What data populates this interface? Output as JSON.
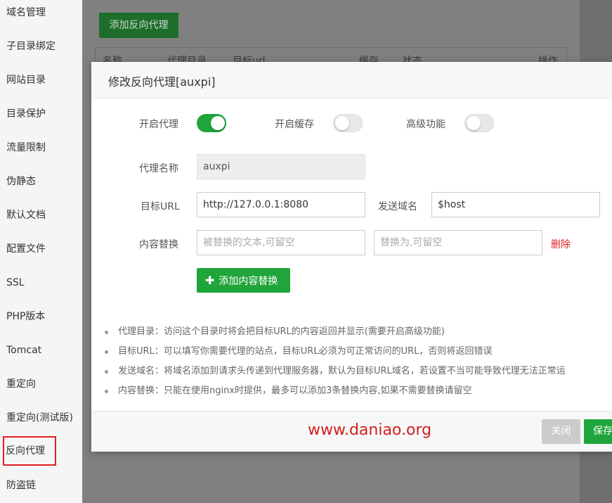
{
  "sidebar": {
    "items": [
      {
        "label": "域名管理"
      },
      {
        "label": "子目录绑定"
      },
      {
        "label": "网站目录"
      },
      {
        "label": "目录保护"
      },
      {
        "label": "流量限制"
      },
      {
        "label": "伪静态"
      },
      {
        "label": "默认文档"
      },
      {
        "label": "配置文件"
      },
      {
        "label": "SSL"
      },
      {
        "label": "PHP版本"
      },
      {
        "label": "Tomcat"
      },
      {
        "label": "重定向"
      },
      {
        "label": "重定向(测试版)"
      },
      {
        "label": "反向代理"
      },
      {
        "label": "防盗链"
      }
    ],
    "active": "反向代理"
  },
  "background": {
    "add_button": "添加反向代理",
    "table_headers": [
      "名称",
      "代理目录",
      "目标url",
      "缓存",
      "状态",
      "操作"
    ]
  },
  "modal": {
    "title": "修改反向代理[auxpi]",
    "toggles": {
      "proxy_label": "开启代理",
      "proxy_on": true,
      "cache_label": "开启缓存",
      "cache_on": false,
      "advanced_label": "高级功能",
      "advanced_on": false
    },
    "form": {
      "name_label": "代理名称",
      "name_value": "auxpi",
      "target_label": "目标URL",
      "target_value": "http://127.0.0.1:8080",
      "host_label": "发送域名",
      "host_value": "$host",
      "replace_label": "内容替换",
      "replace_from_placeholder": "被替换的文本,可留空",
      "replace_to_placeholder": "替换为,可留空",
      "delete_label": "删除",
      "add_replace_label": "添加内容替换"
    },
    "tips": [
      "代理目录：访问这个目录时将会把目标URL的内容返回并显示(需要开启高级功能)",
      "目标URL：可以填写你需要代理的站点，目标URL必须为可正常访问的URL，否则将返回错误",
      "发送域名：将域名添加到请求头传递到代理服务器，默认为目标URL域名，若设置不当可能导致代理无法正常运",
      "内容替换：只能在使用nginx时提供，最多可以添加3条替换内容,如果不需要替换请留空"
    ],
    "footer": {
      "watermark": "www.daniao.org",
      "close_label": "关闭",
      "save_label": "保存"
    }
  },
  "colors": {
    "accent": "#20a53a",
    "danger": "#e02020"
  }
}
